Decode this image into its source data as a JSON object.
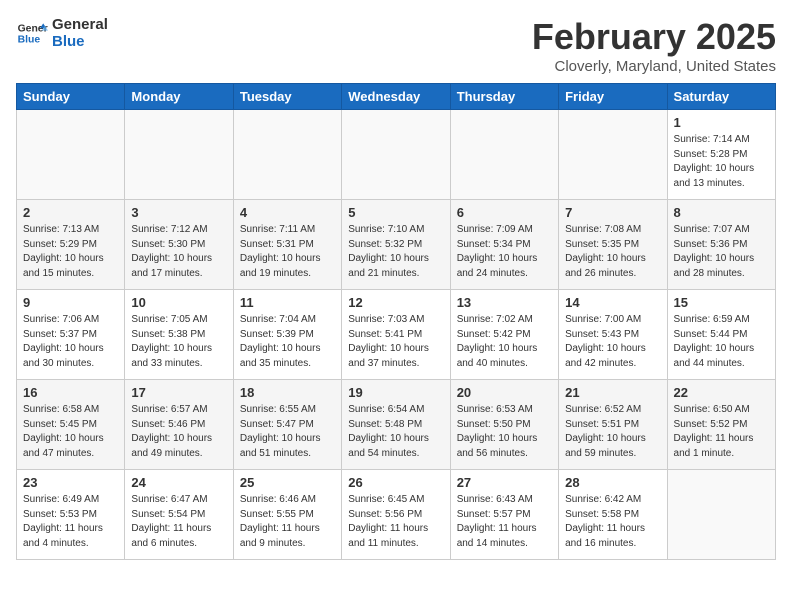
{
  "header": {
    "logo_line1": "General",
    "logo_line2": "Blue",
    "month_title": "February 2025",
    "location": "Cloverly, Maryland, United States"
  },
  "weekdays": [
    "Sunday",
    "Monday",
    "Tuesday",
    "Wednesday",
    "Thursday",
    "Friday",
    "Saturday"
  ],
  "weeks": [
    [
      {
        "day": null,
        "info": null
      },
      {
        "day": null,
        "info": null
      },
      {
        "day": null,
        "info": null
      },
      {
        "day": null,
        "info": null
      },
      {
        "day": null,
        "info": null
      },
      {
        "day": null,
        "info": null
      },
      {
        "day": "1",
        "info": "Sunrise: 7:14 AM\nSunset: 5:28 PM\nDaylight: 10 hours\nand 13 minutes."
      }
    ],
    [
      {
        "day": "2",
        "info": "Sunrise: 7:13 AM\nSunset: 5:29 PM\nDaylight: 10 hours\nand 15 minutes."
      },
      {
        "day": "3",
        "info": "Sunrise: 7:12 AM\nSunset: 5:30 PM\nDaylight: 10 hours\nand 17 minutes."
      },
      {
        "day": "4",
        "info": "Sunrise: 7:11 AM\nSunset: 5:31 PM\nDaylight: 10 hours\nand 19 minutes."
      },
      {
        "day": "5",
        "info": "Sunrise: 7:10 AM\nSunset: 5:32 PM\nDaylight: 10 hours\nand 21 minutes."
      },
      {
        "day": "6",
        "info": "Sunrise: 7:09 AM\nSunset: 5:34 PM\nDaylight: 10 hours\nand 24 minutes."
      },
      {
        "day": "7",
        "info": "Sunrise: 7:08 AM\nSunset: 5:35 PM\nDaylight: 10 hours\nand 26 minutes."
      },
      {
        "day": "8",
        "info": "Sunrise: 7:07 AM\nSunset: 5:36 PM\nDaylight: 10 hours\nand 28 minutes."
      }
    ],
    [
      {
        "day": "9",
        "info": "Sunrise: 7:06 AM\nSunset: 5:37 PM\nDaylight: 10 hours\nand 30 minutes."
      },
      {
        "day": "10",
        "info": "Sunrise: 7:05 AM\nSunset: 5:38 PM\nDaylight: 10 hours\nand 33 minutes."
      },
      {
        "day": "11",
        "info": "Sunrise: 7:04 AM\nSunset: 5:39 PM\nDaylight: 10 hours\nand 35 minutes."
      },
      {
        "day": "12",
        "info": "Sunrise: 7:03 AM\nSunset: 5:41 PM\nDaylight: 10 hours\nand 37 minutes."
      },
      {
        "day": "13",
        "info": "Sunrise: 7:02 AM\nSunset: 5:42 PM\nDaylight: 10 hours\nand 40 minutes."
      },
      {
        "day": "14",
        "info": "Sunrise: 7:00 AM\nSunset: 5:43 PM\nDaylight: 10 hours\nand 42 minutes."
      },
      {
        "day": "15",
        "info": "Sunrise: 6:59 AM\nSunset: 5:44 PM\nDaylight: 10 hours\nand 44 minutes."
      }
    ],
    [
      {
        "day": "16",
        "info": "Sunrise: 6:58 AM\nSunset: 5:45 PM\nDaylight: 10 hours\nand 47 minutes."
      },
      {
        "day": "17",
        "info": "Sunrise: 6:57 AM\nSunset: 5:46 PM\nDaylight: 10 hours\nand 49 minutes."
      },
      {
        "day": "18",
        "info": "Sunrise: 6:55 AM\nSunset: 5:47 PM\nDaylight: 10 hours\nand 51 minutes."
      },
      {
        "day": "19",
        "info": "Sunrise: 6:54 AM\nSunset: 5:48 PM\nDaylight: 10 hours\nand 54 minutes."
      },
      {
        "day": "20",
        "info": "Sunrise: 6:53 AM\nSunset: 5:50 PM\nDaylight: 10 hours\nand 56 minutes."
      },
      {
        "day": "21",
        "info": "Sunrise: 6:52 AM\nSunset: 5:51 PM\nDaylight: 10 hours\nand 59 minutes."
      },
      {
        "day": "22",
        "info": "Sunrise: 6:50 AM\nSunset: 5:52 PM\nDaylight: 11 hours\nand 1 minute."
      }
    ],
    [
      {
        "day": "23",
        "info": "Sunrise: 6:49 AM\nSunset: 5:53 PM\nDaylight: 11 hours\nand 4 minutes."
      },
      {
        "day": "24",
        "info": "Sunrise: 6:47 AM\nSunset: 5:54 PM\nDaylight: 11 hours\nand 6 minutes."
      },
      {
        "day": "25",
        "info": "Sunrise: 6:46 AM\nSunset: 5:55 PM\nDaylight: 11 hours\nand 9 minutes."
      },
      {
        "day": "26",
        "info": "Sunrise: 6:45 AM\nSunset: 5:56 PM\nDaylight: 11 hours\nand 11 minutes."
      },
      {
        "day": "27",
        "info": "Sunrise: 6:43 AM\nSunset: 5:57 PM\nDaylight: 11 hours\nand 14 minutes."
      },
      {
        "day": "28",
        "info": "Sunrise: 6:42 AM\nSunset: 5:58 PM\nDaylight: 11 hours\nand 16 minutes."
      },
      {
        "day": null,
        "info": null
      }
    ]
  ]
}
